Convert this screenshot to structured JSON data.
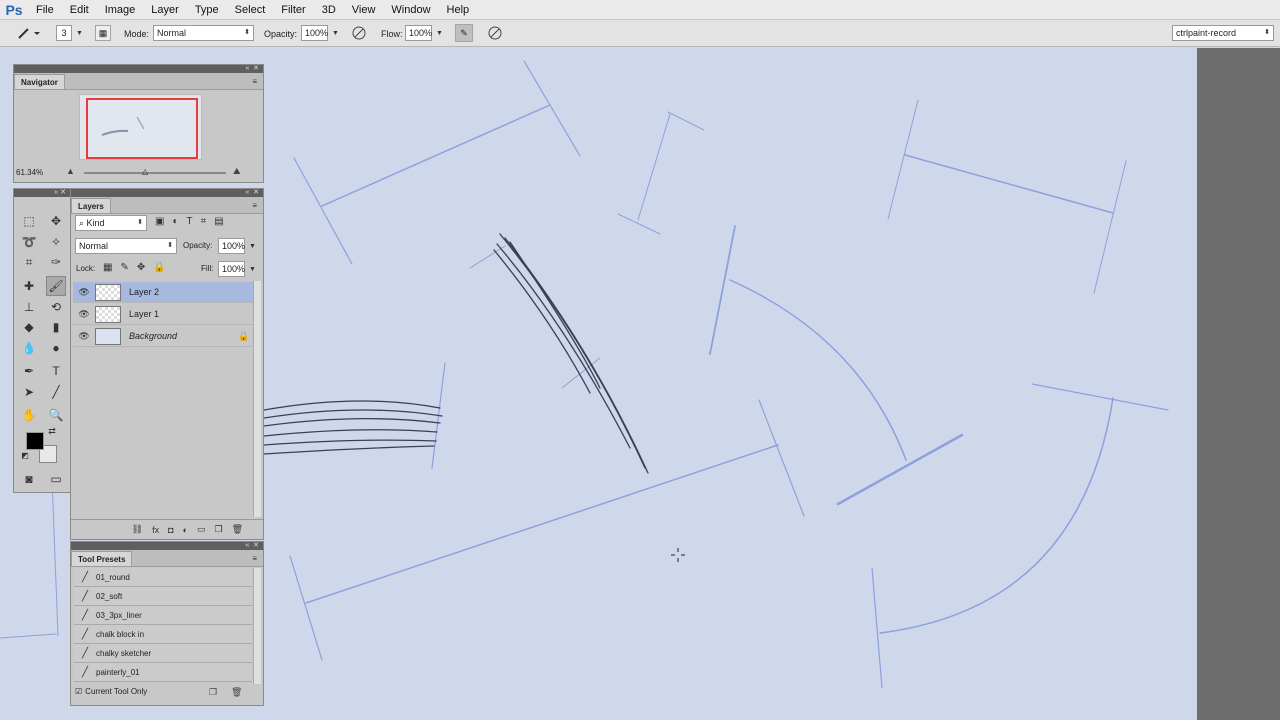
{
  "app": {
    "logo": "Ps"
  },
  "menu": [
    "File",
    "Edit",
    "Image",
    "Layer",
    "Type",
    "Select",
    "Filter",
    "3D",
    "View",
    "Window",
    "Help"
  ],
  "options": {
    "brush_size": "3",
    "mode_label": "Mode:",
    "mode_value": "Normal",
    "opacity_label": "Opacity:",
    "opacity_value": "100%",
    "flow_label": "Flow:",
    "flow_value": "100%",
    "workspace": "ctrlpaint-record"
  },
  "navigator": {
    "title": "Navigator",
    "zoom": "61.34%"
  },
  "layers": {
    "title": "Layers",
    "filter_kind": "Kind",
    "blend_mode": "Normal",
    "opacity_label": "Opacity:",
    "opacity_value": "100%",
    "lock_label": "Lock:",
    "fill_label": "Fill:",
    "fill_value": "100%",
    "items": [
      {
        "name": "Layer 2",
        "selected": true
      },
      {
        "name": "Layer 1",
        "selected": false
      },
      {
        "name": "Background",
        "selected": false,
        "locked": true
      }
    ]
  },
  "tool_presets": {
    "title": "Tool Presets",
    "items": [
      "01_round",
      "02_soft",
      "03_3px_liner",
      "chalk block in",
      "chalky sketcher",
      "painterly_01"
    ],
    "footer_checkbox": "Current Tool Only"
  },
  "colors": {
    "foreground": "#000000",
    "background": "#e8e8e8",
    "canvas": "#cfd8eb",
    "sketch_blue": "#8ea0dc",
    "sketch_dark": "#3a3f55"
  }
}
